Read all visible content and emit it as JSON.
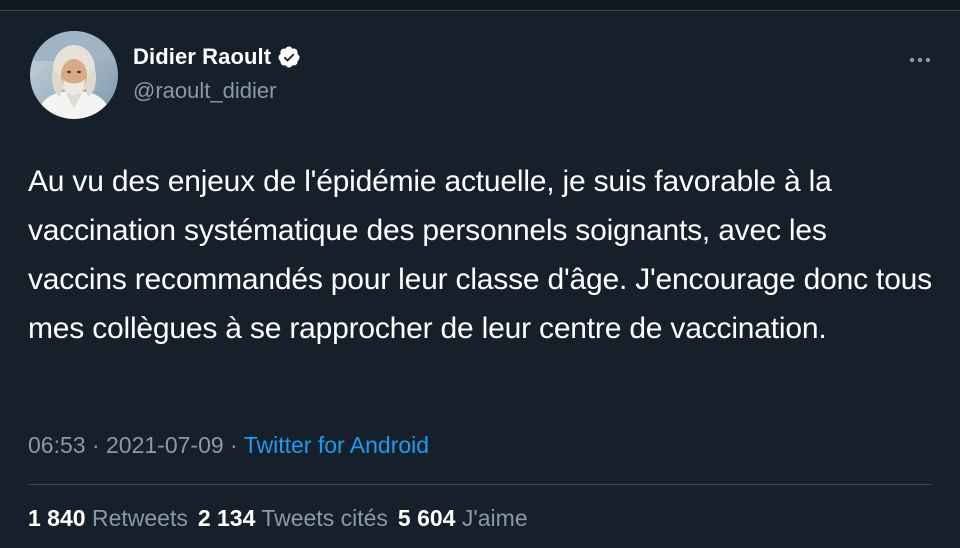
{
  "author": {
    "display_name": "Didier Raoult",
    "handle": "@raoult_didier",
    "verified": true
  },
  "icons": {
    "avatar": "avatar",
    "verified": "verified-badge-icon",
    "more": "more-options-icon"
  },
  "tweet": {
    "text": "Au vu des enjeux de l'épidémie actuelle, je suis favorable à la vaccination systématique des personnels soignants, avec les vaccins recommandés pour leur classe d'âge. J'encourage donc tous mes collègues à se rapprocher de leur centre de vaccination.",
    "time": "06:53",
    "separator_1": " · ",
    "date": "2021-07-09",
    "separator_2": " · ",
    "source": "Twitter for Android"
  },
  "stats": {
    "retweets_count": "1 840",
    "retweets_label": "Retweets",
    "quotes_count": "2 134",
    "quotes_label": "Tweets cités",
    "likes_count": "5 604",
    "likes_label": "J'aime"
  },
  "colors": {
    "background": "#15202b",
    "text_primary": "#ffffff",
    "text_secondary": "#8b98a5",
    "link": "#1d9bf0",
    "border": "#38444d"
  }
}
